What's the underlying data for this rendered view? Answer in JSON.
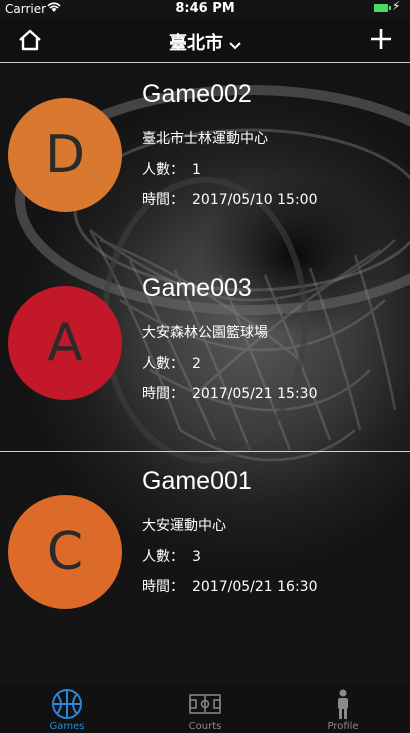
{
  "status_bar": {
    "carrier": "Carrier",
    "time": "8:46 PM"
  },
  "nav": {
    "title": "臺北市"
  },
  "games": [
    {
      "letter": "D",
      "name": "Game002",
      "location": "臺北市士林運動中心",
      "count_label": "人數：",
      "count": "1",
      "time_label": "時間：",
      "time": "2017/05/10 15:00",
      "color": "#d9782f"
    },
    {
      "letter": "A",
      "name": "Game003",
      "location": "大安森林公園籃球場",
      "count_label": "人數：",
      "count": "2",
      "time_label": "時間：",
      "time": "2017/05/21 15:30",
      "color": "#c3182a"
    },
    {
      "letter": "C",
      "name": "Game001",
      "location": "大安運動中心",
      "count_label": "人數：",
      "count": "3",
      "time_label": "時間：",
      "time": "2017/05/21 16:30",
      "color": "#dc6a28"
    }
  ],
  "tabs": [
    {
      "label": "Games",
      "icon": "basketball-icon",
      "active": true
    },
    {
      "label": "Courts",
      "icon": "court-icon",
      "active": false
    },
    {
      "label": "Profile",
      "icon": "player-icon",
      "active": false
    }
  ],
  "colors": {
    "accent": "#2a86d9",
    "battery": "#4cd964"
  }
}
